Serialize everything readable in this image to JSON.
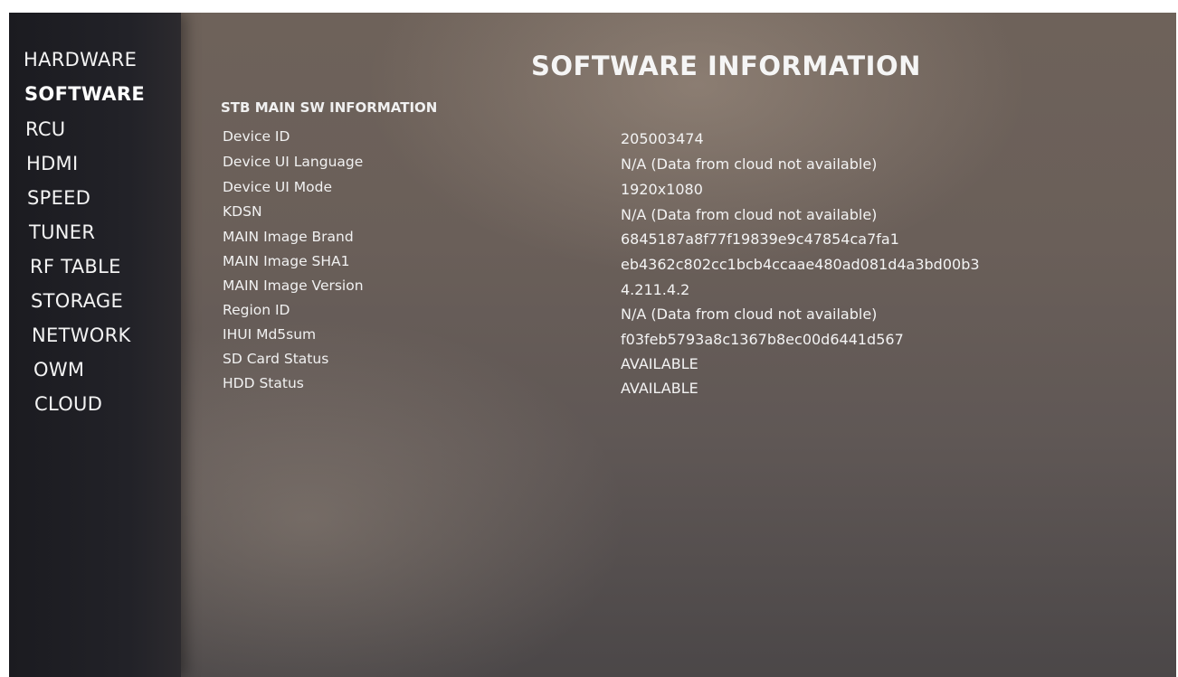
{
  "sidebar": {
    "items": [
      {
        "label": "HARDWARE"
      },
      {
        "label": "SOFTWARE"
      },
      {
        "label": "RCU"
      },
      {
        "label": "HDMI"
      },
      {
        "label": "SPEED"
      },
      {
        "label": "TUNER"
      },
      {
        "label": "RF TABLE"
      },
      {
        "label": "STORAGE"
      },
      {
        "label": "NETWORK"
      },
      {
        "label": "OWM"
      },
      {
        "label": "CLOUD"
      }
    ],
    "active": "SOFTWARE"
  },
  "main": {
    "title": "SOFTWARE INFORMATION",
    "section_title": "STB MAIN SW INFORMATION",
    "rows": [
      {
        "label": "Device ID",
        "value": "205003474"
      },
      {
        "label": "Device UI Language",
        "value": "N/A (Data from cloud not available)"
      },
      {
        "label": "Device UI Mode",
        "value": "1920x1080"
      },
      {
        "label": "KDSN",
        "value": "N/A (Data from cloud not available)"
      },
      {
        "label": "MAIN Image Brand",
        "value": "6845187a8f77f19839e9c47854ca7fa1"
      },
      {
        "label": "MAIN Image SHA1",
        "value": "eb4362c802cc1bcb4ccaae480ad081d4a3bd00b3"
      },
      {
        "label": "MAIN Image Version",
        "value": "4.211.4.2"
      },
      {
        "label": "Region ID",
        "value": "N/A (Data from cloud not available)"
      },
      {
        "label": "IHUI Md5sum",
        "value": "f03feb5793a8c1367b8ec00d6441d567"
      },
      {
        "label": "SD Card Status",
        "value": "AVAILABLE"
      },
      {
        "label": "HDD Status",
        "value": "AVAILABLE"
      }
    ]
  }
}
